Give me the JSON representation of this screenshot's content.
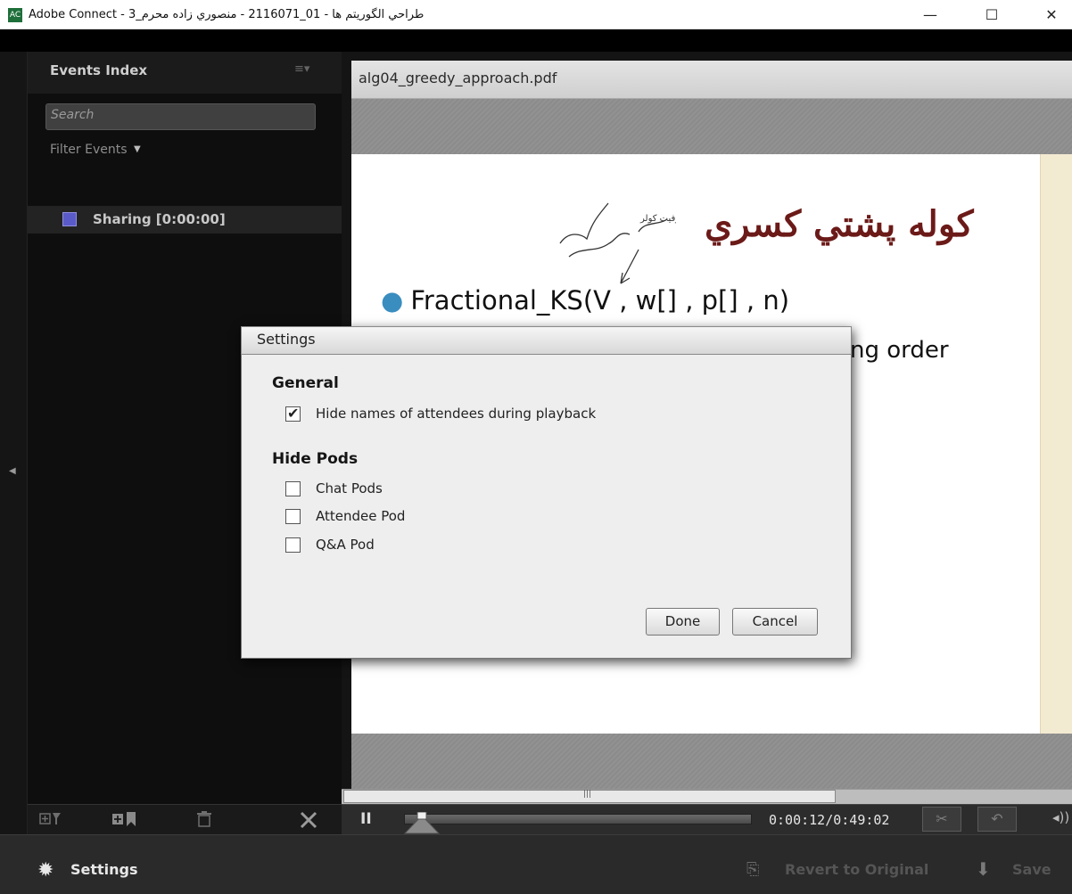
{
  "window": {
    "title": "Adobe Connect - طراحي الگوريتم ها - 01_2116071 - منصوري زاده محرم_3",
    "app_icon_label": "AC",
    "minimize_glyph": "—",
    "maximize_glyph": "☐",
    "close_glyph": "✕"
  },
  "events_panel": {
    "title": "Events Index",
    "menu_glyph": "≡▾",
    "search_placeholder": "Search",
    "filter_label": "Filter Events",
    "filter_caret": "▼",
    "events": [
      {
        "label": "Sharing [0:00:00]",
        "icon": "share-pod-icon"
      }
    ],
    "toolbar_icons": [
      "add-filter-icon",
      "add-bookmark-icon",
      "delete-icon",
      "tools-icon"
    ],
    "collapse_glyph": "◀"
  },
  "document_pod": {
    "file_name": "alg04_greedy_approach.pdf",
    "slide": {
      "heading": "كوله پشتي كسري",
      "bullet": "Fractional_KS(V , w[] , p[] , n)",
      "partial_text": "ng order",
      "handwriting": "ظرفيت كولر"
    },
    "scroll_grip": "|||"
  },
  "playback": {
    "pause_glyph": "II",
    "progress_fraction": 0.004,
    "timecode": "0:00:12/0:49:02",
    "cut_glyph": "✂",
    "undo_glyph": "↶",
    "volume_glyph": "◂))"
  },
  "bottom_bar": {
    "settings_glyph": "✹",
    "settings_label": "Settings",
    "revert_glyph": "⎘",
    "revert_label": "Revert to Original",
    "save_glyph": "⬇",
    "save_label": "Save"
  },
  "settings_dialog": {
    "title": "Settings",
    "general_heading": "General",
    "general_options": [
      {
        "label": "Hide names of attendees during playback",
        "checked": true
      }
    ],
    "hide_pods_heading": "Hide Pods",
    "hide_pods_options": [
      {
        "label": "Chat Pods",
        "checked": false
      },
      {
        "label": "Attendee Pod",
        "checked": false
      },
      {
        "label": "Q&A Pod",
        "checked": false
      }
    ],
    "check_glyph": "✔",
    "done_label": "Done",
    "cancel_label": "Cancel"
  },
  "colors": {
    "slide_heading": "#6b1a18",
    "bullet_dot": "#3a8dbf",
    "panel_bg": "#0e0e0e",
    "dialog_bg": "#eeeeee"
  }
}
